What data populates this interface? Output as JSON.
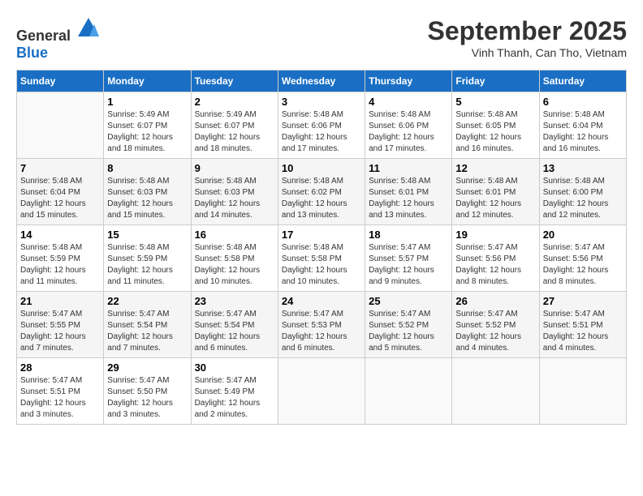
{
  "header": {
    "logo_general": "General",
    "logo_blue": "Blue",
    "month_title": "September 2025",
    "location": "Vinh Thanh, Can Tho, Vietnam"
  },
  "calendar": {
    "days_of_week": [
      "Sunday",
      "Monday",
      "Tuesday",
      "Wednesday",
      "Thursday",
      "Friday",
      "Saturday"
    ],
    "weeks": [
      [
        {
          "day": "",
          "info": ""
        },
        {
          "day": "1",
          "info": "Sunrise: 5:49 AM\nSunset: 6:07 PM\nDaylight: 12 hours\nand 18 minutes."
        },
        {
          "day": "2",
          "info": "Sunrise: 5:49 AM\nSunset: 6:07 PM\nDaylight: 12 hours\nand 18 minutes."
        },
        {
          "day": "3",
          "info": "Sunrise: 5:48 AM\nSunset: 6:06 PM\nDaylight: 12 hours\nand 17 minutes."
        },
        {
          "day": "4",
          "info": "Sunrise: 5:48 AM\nSunset: 6:06 PM\nDaylight: 12 hours\nand 17 minutes."
        },
        {
          "day": "5",
          "info": "Sunrise: 5:48 AM\nSunset: 6:05 PM\nDaylight: 12 hours\nand 16 minutes."
        },
        {
          "day": "6",
          "info": "Sunrise: 5:48 AM\nSunset: 6:04 PM\nDaylight: 12 hours\nand 16 minutes."
        }
      ],
      [
        {
          "day": "7",
          "info": "Sunrise: 5:48 AM\nSunset: 6:04 PM\nDaylight: 12 hours\nand 15 minutes."
        },
        {
          "day": "8",
          "info": "Sunrise: 5:48 AM\nSunset: 6:03 PM\nDaylight: 12 hours\nand 15 minutes."
        },
        {
          "day": "9",
          "info": "Sunrise: 5:48 AM\nSunset: 6:03 PM\nDaylight: 12 hours\nand 14 minutes."
        },
        {
          "day": "10",
          "info": "Sunrise: 5:48 AM\nSunset: 6:02 PM\nDaylight: 12 hours\nand 13 minutes."
        },
        {
          "day": "11",
          "info": "Sunrise: 5:48 AM\nSunset: 6:01 PM\nDaylight: 12 hours\nand 13 minutes."
        },
        {
          "day": "12",
          "info": "Sunrise: 5:48 AM\nSunset: 6:01 PM\nDaylight: 12 hours\nand 12 minutes."
        },
        {
          "day": "13",
          "info": "Sunrise: 5:48 AM\nSunset: 6:00 PM\nDaylight: 12 hours\nand 12 minutes."
        }
      ],
      [
        {
          "day": "14",
          "info": "Sunrise: 5:48 AM\nSunset: 5:59 PM\nDaylight: 12 hours\nand 11 minutes."
        },
        {
          "day": "15",
          "info": "Sunrise: 5:48 AM\nSunset: 5:59 PM\nDaylight: 12 hours\nand 11 minutes."
        },
        {
          "day": "16",
          "info": "Sunrise: 5:48 AM\nSunset: 5:58 PM\nDaylight: 12 hours\nand 10 minutes."
        },
        {
          "day": "17",
          "info": "Sunrise: 5:48 AM\nSunset: 5:58 PM\nDaylight: 12 hours\nand 10 minutes."
        },
        {
          "day": "18",
          "info": "Sunrise: 5:47 AM\nSunset: 5:57 PM\nDaylight: 12 hours\nand 9 minutes."
        },
        {
          "day": "19",
          "info": "Sunrise: 5:47 AM\nSunset: 5:56 PM\nDaylight: 12 hours\nand 8 minutes."
        },
        {
          "day": "20",
          "info": "Sunrise: 5:47 AM\nSunset: 5:56 PM\nDaylight: 12 hours\nand 8 minutes."
        }
      ],
      [
        {
          "day": "21",
          "info": "Sunrise: 5:47 AM\nSunset: 5:55 PM\nDaylight: 12 hours\nand 7 minutes."
        },
        {
          "day": "22",
          "info": "Sunrise: 5:47 AM\nSunset: 5:54 PM\nDaylight: 12 hours\nand 7 minutes."
        },
        {
          "day": "23",
          "info": "Sunrise: 5:47 AM\nSunset: 5:54 PM\nDaylight: 12 hours\nand 6 minutes."
        },
        {
          "day": "24",
          "info": "Sunrise: 5:47 AM\nSunset: 5:53 PM\nDaylight: 12 hours\nand 6 minutes."
        },
        {
          "day": "25",
          "info": "Sunrise: 5:47 AM\nSunset: 5:52 PM\nDaylight: 12 hours\nand 5 minutes."
        },
        {
          "day": "26",
          "info": "Sunrise: 5:47 AM\nSunset: 5:52 PM\nDaylight: 12 hours\nand 4 minutes."
        },
        {
          "day": "27",
          "info": "Sunrise: 5:47 AM\nSunset: 5:51 PM\nDaylight: 12 hours\nand 4 minutes."
        }
      ],
      [
        {
          "day": "28",
          "info": "Sunrise: 5:47 AM\nSunset: 5:51 PM\nDaylight: 12 hours\nand 3 minutes."
        },
        {
          "day": "29",
          "info": "Sunrise: 5:47 AM\nSunset: 5:50 PM\nDaylight: 12 hours\nand 3 minutes."
        },
        {
          "day": "30",
          "info": "Sunrise: 5:47 AM\nSunset: 5:49 PM\nDaylight: 12 hours\nand 2 minutes."
        },
        {
          "day": "",
          "info": ""
        },
        {
          "day": "",
          "info": ""
        },
        {
          "day": "",
          "info": ""
        },
        {
          "day": "",
          "info": ""
        }
      ]
    ]
  }
}
